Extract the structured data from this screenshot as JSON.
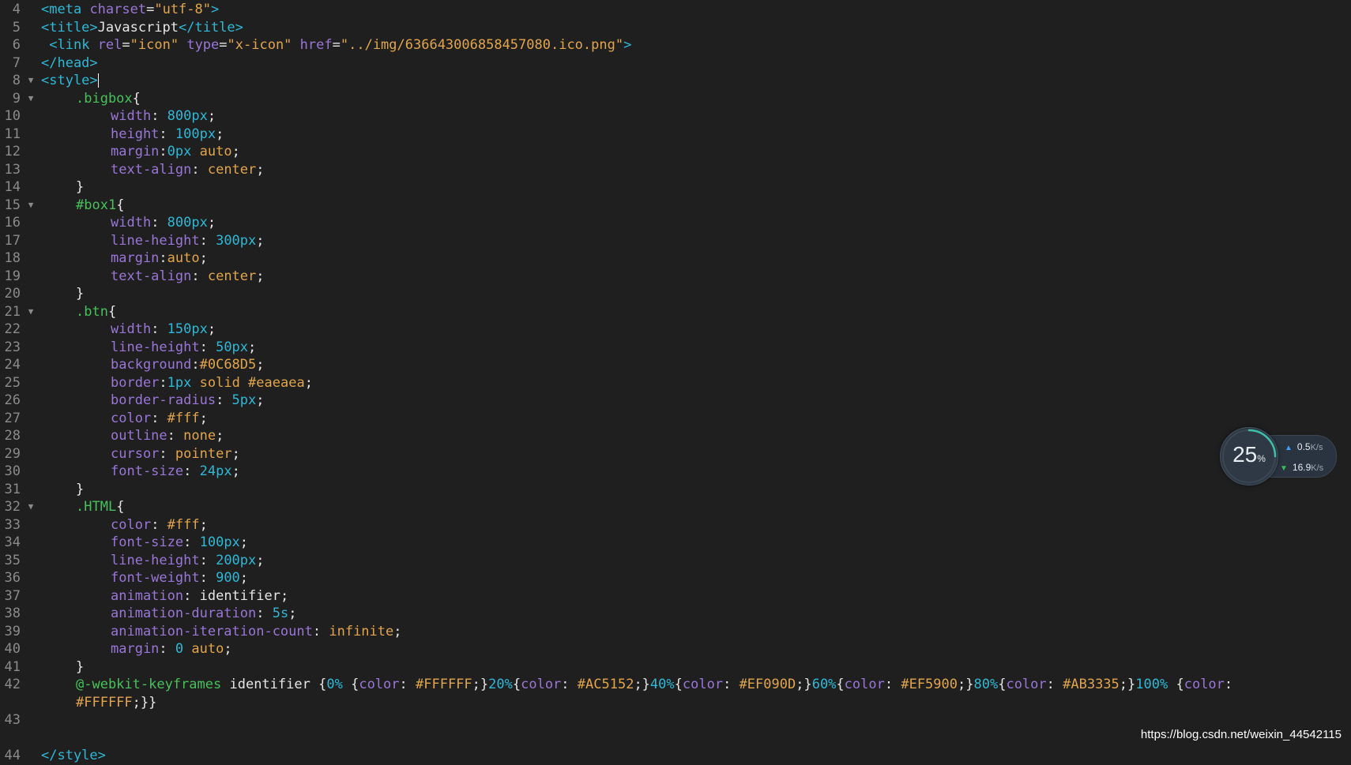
{
  "editor": {
    "lines": [
      {
        "n": "4",
        "html": "<span class='t-tag'>&lt;meta</span> <span class='t-attr'>charset</span><span class='t-punc'>=</span><span class='t-str'>\"utf-8\"</span><span class='t-tag'>&gt;</span>"
      },
      {
        "n": "5",
        "html": "<span class='t-tag'>&lt;title&gt;</span><span class='t-text'>Javascript</span><span class='t-tag'>&lt;/title&gt;</span>"
      },
      {
        "n": "6",
        "html": " <span class='t-tag'>&lt;link</span> <span class='t-attr'>rel</span><span class='t-punc'>=</span><span class='t-str'>\"icon\"</span> <span class='t-attr'>type</span><span class='t-punc'>=</span><span class='t-str'>\"x-icon\"</span> <span class='t-attr'>href</span><span class='t-punc'>=</span><span class='t-str'>\"../img/636643006858457080.ico.png\"</span><span class='t-tag'>&gt;</span>"
      },
      {
        "n": "7",
        "html": "<span class='t-tag'>&lt;/head&gt;</span>"
      },
      {
        "n": "8",
        "fold": true,
        "html": "<span class='t-tag'>&lt;style&gt;</span><span class='caret'></span>"
      },
      {
        "n": "9",
        "fold": true,
        "indent": 1,
        "html": "<span class='t-sel'>.bigbox</span><span class='t-punc'>{</span>"
      },
      {
        "n": "10",
        "indent": 2,
        "html": "<span class='t-prop'>width</span><span class='t-punc'>: </span><span class='t-num'>800px</span><span class='t-punc'>;</span>"
      },
      {
        "n": "11",
        "indent": 2,
        "html": "<span class='t-prop'>height</span><span class='t-punc'>: </span><span class='t-num'>100px</span><span class='t-punc'>;</span>"
      },
      {
        "n": "12",
        "indent": 2,
        "html": "<span class='t-prop'>margin</span><span class='t-punc'>:</span><span class='t-num'>0px</span> <span class='t-val'>auto</span><span class='t-punc'>;</span>"
      },
      {
        "n": "13",
        "indent": 2,
        "html": "<span class='t-prop'>text-align</span><span class='t-punc'>: </span><span class='t-val'>center</span><span class='t-punc'>;</span>"
      },
      {
        "n": "14",
        "indent": 1,
        "html": "<span class='t-punc'>}</span>"
      },
      {
        "n": "15",
        "fold": true,
        "indent": 1,
        "html": "<span class='t-sel'>#box1</span><span class='t-punc'>{</span>"
      },
      {
        "n": "16",
        "indent": 2,
        "html": "<span class='t-prop'>width</span><span class='t-punc'>: </span><span class='t-num'>800px</span><span class='t-punc'>;</span>"
      },
      {
        "n": "17",
        "indent": 2,
        "html": "<span class='t-prop'>line-height</span><span class='t-punc'>: </span><span class='t-num'>300px</span><span class='t-punc'>;</span>"
      },
      {
        "n": "18",
        "indent": 2,
        "html": "<span class='t-prop'>margin</span><span class='t-punc'>:</span><span class='t-val'>auto</span><span class='t-punc'>;</span>"
      },
      {
        "n": "19",
        "indent": 2,
        "html": "<span class='t-prop'>text-align</span><span class='t-punc'>: </span><span class='t-val'>center</span><span class='t-punc'>;</span>"
      },
      {
        "n": "20",
        "indent": 1,
        "html": "<span class='t-punc'>}</span>"
      },
      {
        "n": "21",
        "fold": true,
        "indent": 1,
        "html": "<span class='t-sel'>.btn</span><span class='t-punc'>{</span>"
      },
      {
        "n": "22",
        "indent": 2,
        "html": "<span class='t-prop'>width</span><span class='t-punc'>: </span><span class='t-num'>150px</span><span class='t-punc'>;</span>"
      },
      {
        "n": "23",
        "indent": 2,
        "html": "<span class='t-prop'>line-height</span><span class='t-punc'>: </span><span class='t-num'>50px</span><span class='t-punc'>;</span>"
      },
      {
        "n": "24",
        "indent": 2,
        "html": "<span class='t-prop'>background</span><span class='t-punc'>:</span><span class='t-val'>#0C68D5</span><span class='t-punc'>;</span>"
      },
      {
        "n": "25",
        "indent": 2,
        "html": "<span class='t-prop'>border</span><span class='t-punc'>:</span><span class='t-num'>1px</span> <span class='t-val'>solid #eaeaea</span><span class='t-punc'>;</span>"
      },
      {
        "n": "26",
        "indent": 2,
        "html": "<span class='t-prop'>border-radius</span><span class='t-punc'>: </span><span class='t-num'>5px</span><span class='t-punc'>;</span>"
      },
      {
        "n": "27",
        "indent": 2,
        "html": "<span class='t-prop'>color</span><span class='t-punc'>: </span><span class='t-val'>#fff</span><span class='t-punc'>;</span>"
      },
      {
        "n": "28",
        "indent": 2,
        "html": "<span class='t-prop'>outline</span><span class='t-punc'>: </span><span class='t-val'>none</span><span class='t-punc'>;</span>"
      },
      {
        "n": "29",
        "indent": 2,
        "html": "<span class='t-prop'>cursor</span><span class='t-punc'>: </span><span class='t-val'>pointer</span><span class='t-punc'>;</span>"
      },
      {
        "n": "30",
        "indent": 2,
        "html": "<span class='t-prop'>font-size</span><span class='t-punc'>: </span><span class='t-num'>24px</span><span class='t-punc'>;</span>"
      },
      {
        "n": "31",
        "indent": 1,
        "html": "<span class='t-punc'>}</span>"
      },
      {
        "n": "32",
        "fold": true,
        "indent": 1,
        "html": "<span class='t-sel'>.HTML</span><span class='t-punc'>{</span>"
      },
      {
        "n": "33",
        "indent": 2,
        "html": "<span class='t-prop'>color</span><span class='t-punc'>: </span><span class='t-val'>#fff</span><span class='t-punc'>;</span>"
      },
      {
        "n": "34",
        "indent": 2,
        "html": "<span class='t-prop'>font-size</span><span class='t-punc'>: </span><span class='t-num'>100px</span><span class='t-punc'>;</span>"
      },
      {
        "n": "35",
        "indent": 2,
        "html": "<span class='t-prop'>line-height</span><span class='t-punc'>: </span><span class='t-num'>200px</span><span class='t-punc'>;</span>"
      },
      {
        "n": "36",
        "indent": 2,
        "html": "<span class='t-prop'>font-weight</span><span class='t-punc'>: </span><span class='t-num'>900</span><span class='t-punc'>;</span>"
      },
      {
        "n": "37",
        "indent": 2,
        "html": "<span class='t-prop'>animation</span><span class='t-punc'>: </span><span class='t-text'>identifier</span><span class='t-punc'>;</span>"
      },
      {
        "n": "38",
        "indent": 2,
        "html": "<span class='t-prop'>animation-duration</span><span class='t-punc'>: </span><span class='t-num'>5s</span><span class='t-punc'>;</span>"
      },
      {
        "n": "39",
        "indent": 2,
        "html": "<span class='t-prop'>animation-iteration-count</span><span class='t-punc'>: </span><span class='t-val'>infinite</span><span class='t-punc'>;</span>"
      },
      {
        "n": "40",
        "indent": 2,
        "html": "<span class='t-prop'>margin</span><span class='t-punc'>: </span><span class='t-num'>0</span> <span class='t-val'>auto</span><span class='t-punc'>;</span>"
      },
      {
        "n": "41",
        "indent": 1,
        "html": "<span class='t-punc'>}</span>"
      },
      {
        "n": "42",
        "indent": 1,
        "html": "<span class='t-at'>@-webkit-keyframes</span> <span class='t-text'>identifier</span> <span class='t-punc'>{</span><span class='t-num'>0%</span> <span class='t-punc'>{</span><span class='t-prop'>color</span><span class='t-punc'>: </span><span class='t-val'>#FFFFFF</span><span class='t-punc'>;}</span><span class='t-num'>20%</span><span class='t-punc'>{</span><span class='t-prop'>color</span><span class='t-punc'>: </span><span class='t-val'>#AC5152</span><span class='t-punc'>;}</span><span class='t-num'>40%</span><span class='t-punc'>{</span><span class='t-prop'>color</span><span class='t-punc'>: </span><span class='t-val'>#EF090D</span><span class='t-punc'>;}</span><span class='t-num'>60%</span><span class='t-punc'>{</span><span class='t-prop'>color</span><span class='t-punc'>: </span><span class='t-val'>#EF5900</span><span class='t-punc'>;}</span><span class='t-num'>80%</span><span class='t-punc'>{</span><span class='t-prop'>color</span><span class='t-punc'>: </span><span class='t-val'>#AB3335</span><span class='t-punc'>;}</span><span class='t-num'>100%</span> <span class='t-punc'>{</span><span class='t-prop'>color</span><span class='t-punc'>:</span>"
      },
      {
        "n": "",
        "indent": 1,
        "html": "<span class='t-val'>#FFFFFF</span><span class='t-punc'>;}}</span>"
      },
      {
        "n": "43",
        "html": ""
      },
      {
        "n": "",
        "html": ""
      },
      {
        "n": "44",
        "html": "<span class='t-tag'>&lt;/style&gt;</span>"
      }
    ]
  },
  "network_widget": {
    "cpu_percent": "25",
    "percent_symbol": "%",
    "upload_value": "0.5",
    "upload_unit": "K/s",
    "download_value": "16.9",
    "download_unit": "K/s",
    "upload_icon": "arrow-up-icon",
    "download_icon": "arrow-down-icon",
    "ring_fill": 0.25,
    "ring_color": "#3dbfa9"
  },
  "watermark": {
    "text": "https://blog.csdn.net/weixin_44542115"
  }
}
